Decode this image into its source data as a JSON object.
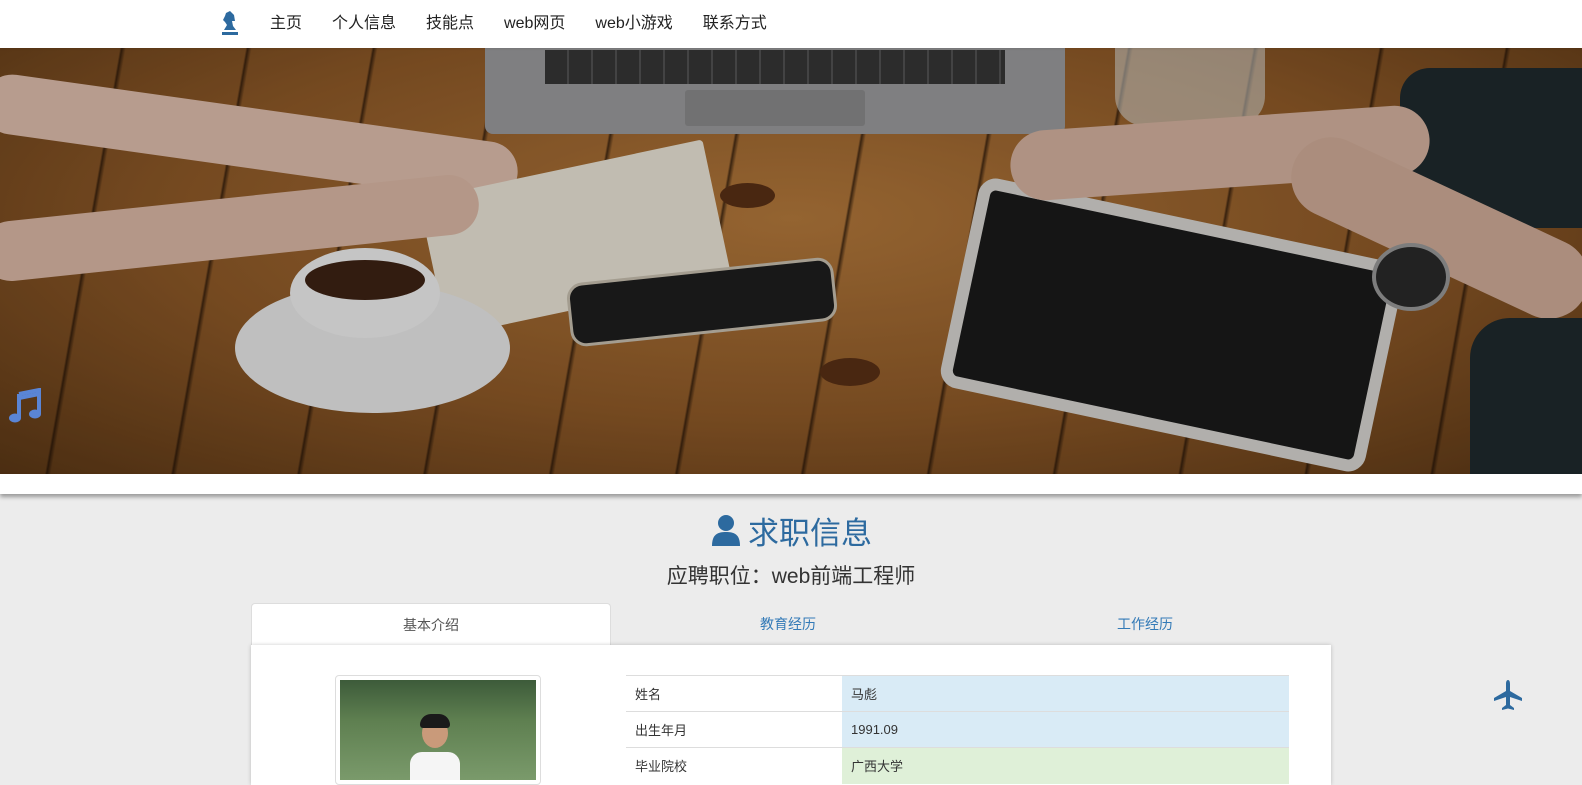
{
  "navbar": {
    "logo_icon": "chess-knight-icon",
    "items": [
      "主页",
      "个人信息",
      "技能点",
      "web网页",
      "web小游戏",
      "联系方式"
    ]
  },
  "hero": {
    "music_icon": "music-note-icon"
  },
  "section": {
    "title": "求职信息",
    "title_icon": "person-icon",
    "position": "应聘职位：web前端工程师"
  },
  "tabs": [
    "基本介绍",
    "教育经历",
    "工作经历"
  ],
  "info_table": [
    {
      "key": "姓名",
      "value": "马彪"
    },
    {
      "key": "出生年月",
      "value": "1991.09"
    },
    {
      "key": "毕业院校",
      "value": "广西大学"
    }
  ],
  "float_button_icon": "airplane-icon",
  "colors": {
    "accent": "#2d6a9f",
    "link": "#337ab7",
    "row_blue": "#d9ebf6",
    "row_green": "#dff0d8",
    "music_icon": "#5a85d6"
  }
}
